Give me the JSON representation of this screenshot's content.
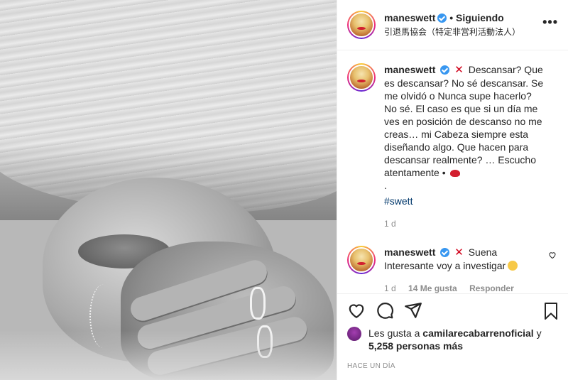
{
  "post": {
    "username": "maneswett",
    "follow_separator": "•",
    "follow_status": "Siguiendo",
    "location": "引退馬協会（特定非営利活動法人）",
    "more_label": "•••"
  },
  "caption": {
    "username": "maneswett",
    "x_mark": "✕",
    "text": "Descansar? Que es descansar? No sé descansar. Se me olvidó o Nunca supe hacerlo? No sé. El caso es que si un día me ves en posición de descanso no me creas… mi Cabeza siempre esta diseñando algo. Que hacen para descansar realmente? … Escucho atentamente •",
    "dot_line": ".",
    "hashtag": "#swett",
    "age": "1 d"
  },
  "reply": {
    "username": "maneswett",
    "x_mark": "✕",
    "text": "Suena Interesante voy a investigar",
    "age": "1 d",
    "likes": "14 Me gusta",
    "reply_label": "Responder"
  },
  "likes": {
    "prefix": "Les gusta a",
    "user": "camilarecabarrenoficial",
    "conj": "y",
    "count": "5,258 personas más"
  },
  "timestamp": "HACE UN DÍA",
  "icons": [
    "verified-icon",
    "heart-icon",
    "comment-icon",
    "share-icon",
    "bookmark-icon",
    "more-icon"
  ]
}
